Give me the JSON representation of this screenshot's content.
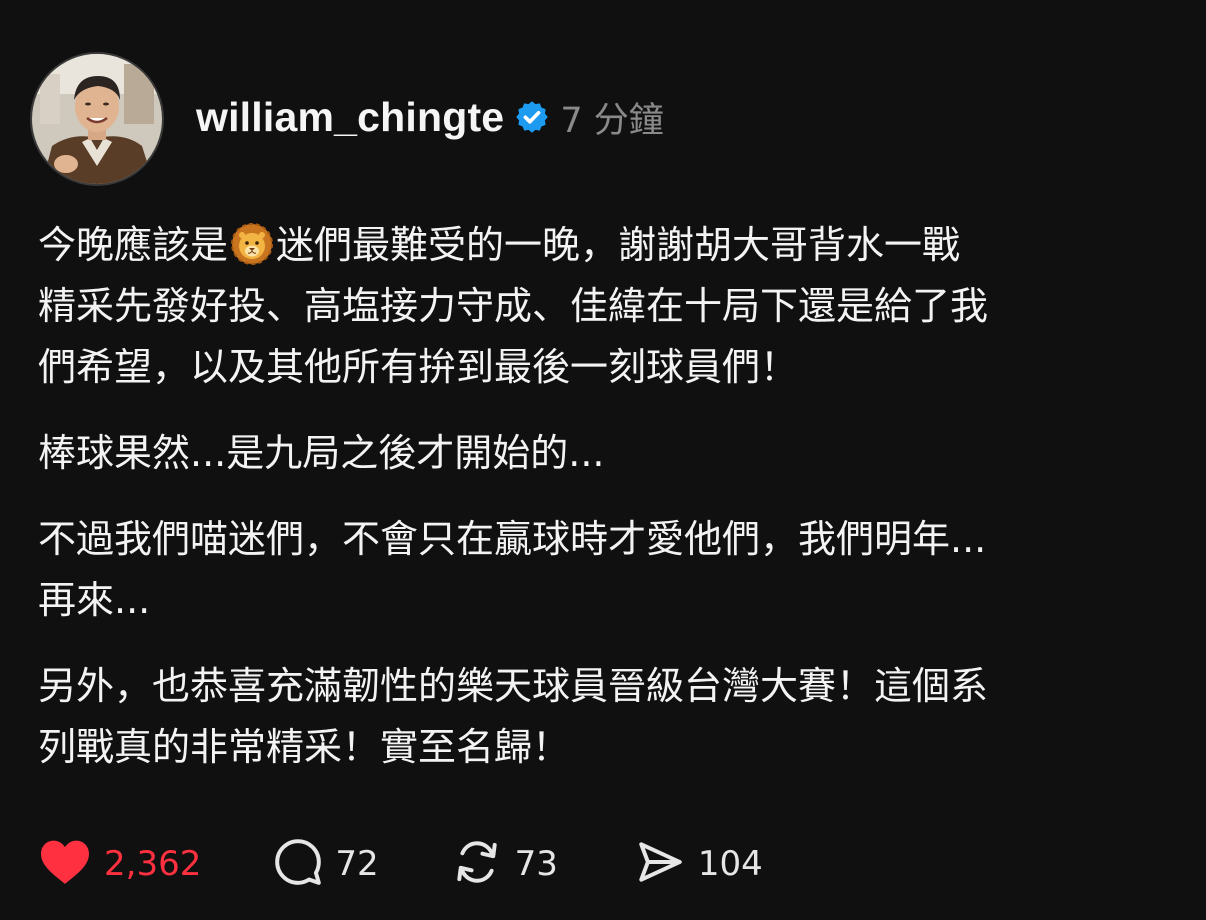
{
  "post": {
    "author": {
      "username": "william_chingte",
      "verified_icon": "verified-badge-icon",
      "timestamp": "7 分鐘"
    },
    "paragraphs": [
      {
        "before_emoji": "今晚應該是",
        "emoji": "lion-face",
        "after_emoji": "迷們最難受的一晚，謝謝胡大哥背水一戰\n精采先發好投、高塩接力守成、佳緯在十局下還是給了我\n們希望，以及其他所有拚到最後一刻球員們！"
      },
      {
        "text": "棒球果然...是九局之後才開始的..."
      },
      {
        "text": "不過我們喵迷們，不會只在贏球時才愛他們，我們明年...\n再來..."
      },
      {
        "text": "另外，也恭喜充滿韌性的樂天球員晉級台灣大賽！這個系\n列戰真的非常精采！實至名歸！"
      }
    ],
    "actions": {
      "like": {
        "icon": "heart-icon",
        "count": "2,362",
        "color": "#ff3040"
      },
      "reply": {
        "icon": "comment-icon",
        "count": "72"
      },
      "repost": {
        "icon": "repost-icon",
        "count": "73"
      },
      "share": {
        "icon": "send-icon",
        "count": "104"
      }
    }
  },
  "colors": {
    "background": "#101010",
    "text": "#f3f3f3",
    "muted": "#8a8a8a",
    "verified": "#1d9bf0",
    "like": "#ff3040"
  }
}
